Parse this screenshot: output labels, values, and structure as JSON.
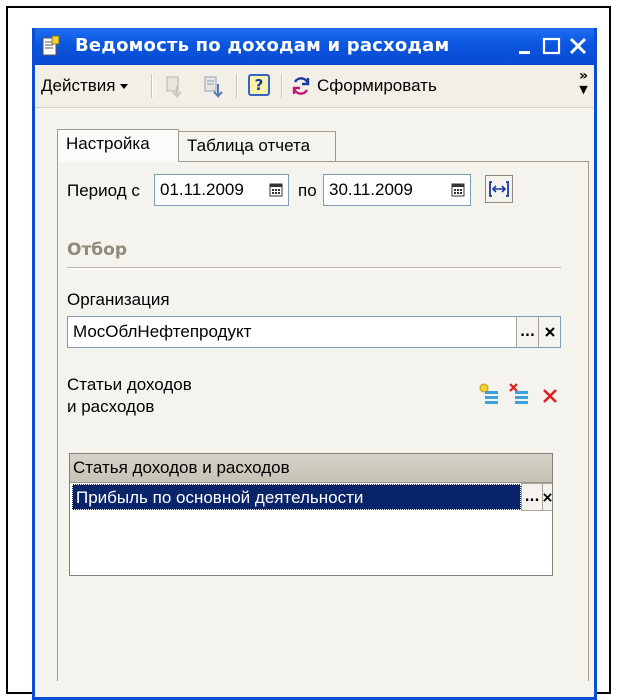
{
  "window": {
    "title": "Ведомость по доходам и расходам",
    "title_bar_color": "#0b55df",
    "selection_color": "#0a246a"
  },
  "toolbar": {
    "actions_label": "Действия",
    "help_label": "?",
    "generate_label": "Сформировать",
    "more_label": "»"
  },
  "tabs": [
    {
      "label": "Настройка",
      "active": true
    },
    {
      "label": "Таблица отчета",
      "active": false
    }
  ],
  "period": {
    "from_label": "Период с",
    "from_value": "01.11.2009",
    "to_label": "по",
    "to_value": "30.11.2009"
  },
  "filter": {
    "section_label": "Отбор",
    "organization_label": "Организация",
    "organization_value": "МосОблНефтепродукт",
    "select_button": "...",
    "clear_button": "x"
  },
  "items": {
    "label_line1": "Статьи доходов",
    "label_line2": "и расходов",
    "table_header": "Статья доходов и расходов",
    "rows": [
      {
        "value": "Прибыль по основной деятельности",
        "selected": true
      }
    ]
  }
}
